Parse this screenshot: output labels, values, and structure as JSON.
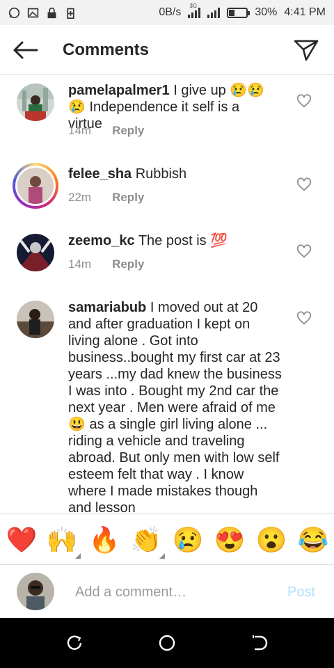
{
  "status_bar": {
    "net_speed": "0B/s",
    "network_label": "3G",
    "battery_percent": 30,
    "battery_text": "30%",
    "time": "4:41 PM"
  },
  "header": {
    "title": "Comments",
    "back_icon": "arrow-left-icon",
    "send_icon": "paper-plane-icon"
  },
  "comments": [
    {
      "username": "pamelapalmer1",
      "text": "I give up 😢😢😢 Independence it self is a virtue",
      "time": "14m",
      "reply_label": "Reply"
    },
    {
      "username": "felee_sha",
      "text": "Rubbish",
      "time": "22m",
      "reply_label": "Reply",
      "has_story_ring": true
    },
    {
      "username": "zeemo_kc",
      "text": "The post is 💯",
      "time": "14m",
      "reply_label": "Reply"
    },
    {
      "username": "samariabub",
      "text": "I moved out at 20 and after graduation I kept on living alone . Got into business..bought my first car at 23 years ...my dad knew the business I was into . Bought my 2nd car the next year . Men were afraid of me 😃 as a single girl living alone ... riding a vehicle and traveling abroad. But only men with low self esteem felt that way . I know where I made mistakes though and lesson"
    }
  ],
  "reactions": [
    "❤️",
    "🙌",
    "🔥",
    "👏",
    "😢",
    "😍",
    "😮",
    "😂"
  ],
  "add_comment": {
    "placeholder": "Add a comment…",
    "post_label": "Post"
  },
  "colors": {
    "post_disabled": "#b2dffc",
    "meta_gray": "#8e8e8e",
    "divider": "#dbdbdb"
  }
}
